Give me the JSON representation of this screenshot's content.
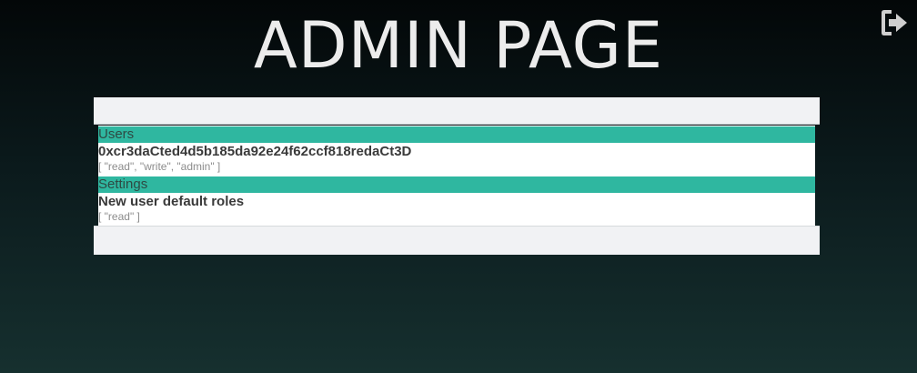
{
  "page": {
    "title": "ADMIN PAGE",
    "logout_icon": "logout-icon"
  },
  "sections": [
    {
      "header": "Users",
      "entries": [
        {
          "title": "0xcr3daCted4d5b185da92e24f62ccf818redaCt3D",
          "roles": "[ \"read\", \"write\", \"admin\" ]"
        }
      ]
    },
    {
      "header": "Settings",
      "entries": [
        {
          "title": "New user default roles",
          "roles": "[ \"read\" ]"
        }
      ]
    }
  ],
  "colors": {
    "section_header": "#2fb7a0",
    "panel_chrome": "#f1f2f4",
    "title_text": "#ececec",
    "background_top": "#030708",
    "background_bottom": "#16302f"
  }
}
